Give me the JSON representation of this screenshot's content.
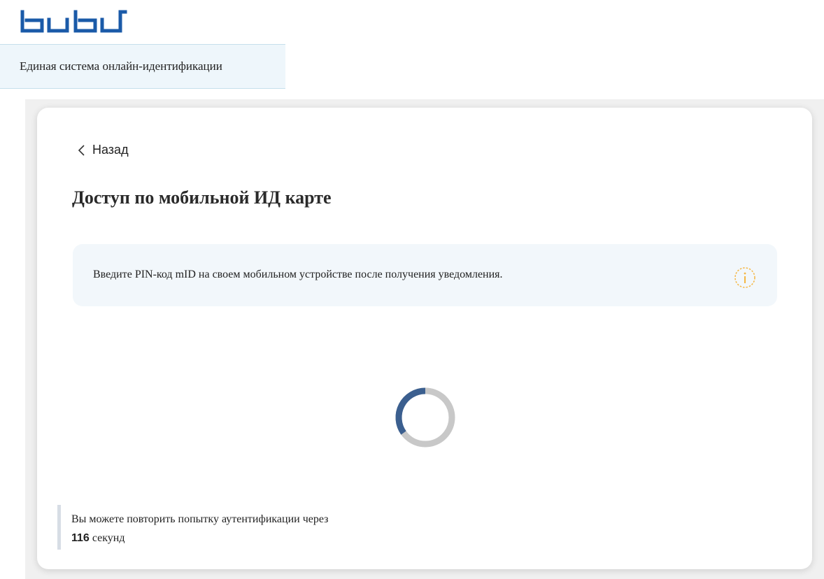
{
  "header": {
    "logo_name": "bubu-logo",
    "subtitle": "Единая система онлайн-идентификации"
  },
  "card": {
    "back_label": "Назад",
    "title": "Доступ по мобильной ИД карте",
    "info_message": "Введите PIN-код mID на своем мобильном устройстве после получения уведомления.",
    "info_icon": "info-icon",
    "retry": {
      "text": "Вы можете повторить попытку аутентификации через",
      "seconds": "116",
      "unit": "секунд"
    }
  },
  "colors": {
    "brand_blue": "#1a5aa8",
    "spinner_active": "#3b5f8f",
    "spinner_track": "#c8c8c8",
    "info_icon": "#f5b642",
    "info_bg": "#f2f7fb",
    "subtitle_bg": "#eef6fb"
  }
}
